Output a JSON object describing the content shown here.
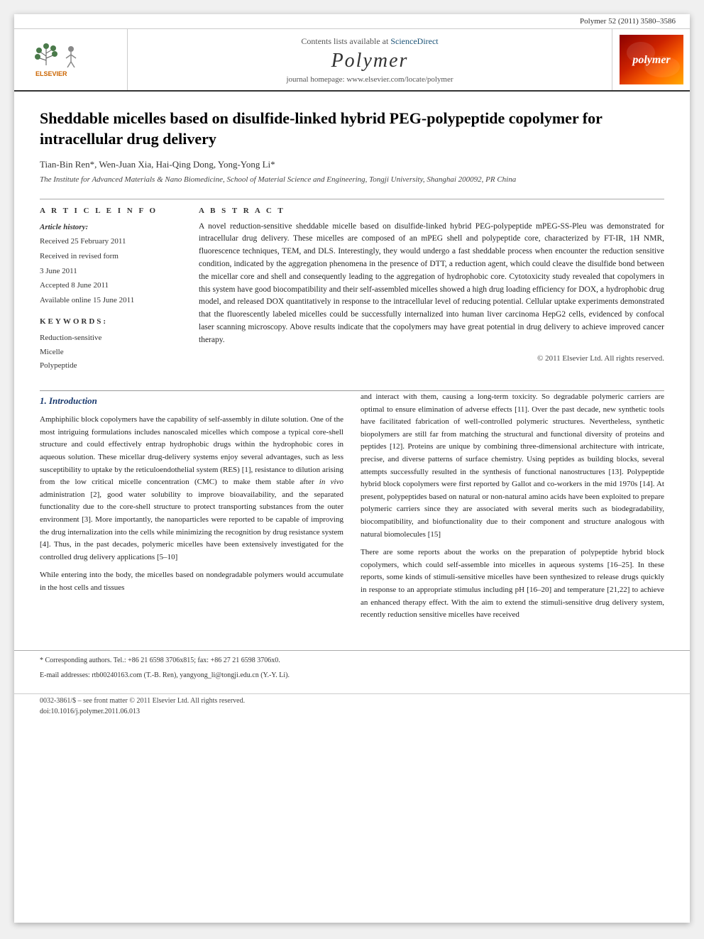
{
  "topbar": {
    "citation": "Polymer 52 (2011) 3580–3586"
  },
  "header": {
    "sciencedirect_text": "Contents lists available at",
    "sciencedirect_link": "ScienceDirect",
    "journal_name": "Polymer",
    "homepage_label": "journal homepage: www.elsevier.com/locate/polymer",
    "polymer_logo_text": "polymer"
  },
  "article": {
    "title": "Sheddable micelles based on disulfide-linked hybrid PEG-polypeptide copolymer for intracellular drug delivery",
    "authors": "Tian-Bin Ren*, Wen-Juan Xia, Hai-Qing Dong, Yong-Yong Li*",
    "affiliation": "The Institute for Advanced Materials & Nano Biomedicine, School of Material Science and Engineering, Tongji University, Shanghai 200092, PR China",
    "info_section_label": "A R T I C L E   I N F O",
    "history_label": "Article history:",
    "received": "Received 25 February 2011",
    "received_revised": "Received in revised form 3 June 2011",
    "accepted": "Accepted 8 June 2011",
    "available": "Available online 15 June 2011",
    "keywords_label": "Keywords:",
    "keyword1": "Reduction-sensitive",
    "keyword2": "Micelle",
    "keyword3": "Polypeptide",
    "abstract_label": "A B S T R A C T",
    "abstract_text": "A novel reduction-sensitive sheddable micelle based on disulfide-linked hybrid PEG-polypeptide mPEG-SS-Pleu was demonstrated for intracellular drug delivery. These micelles are composed of an mPEG shell and polypeptide core, characterized by FT-IR, 1H NMR, fluorescence techniques, TEM, and DLS. Interestingly, they would undergo a fast sheddable process when encounter the reduction sensitive condition, indicated by the aggregation phenomena in the presence of DTT, a reduction agent, which could cleave the disulfide bond between the micellar core and shell and consequently leading to the aggregation of hydrophobic core. Cytotoxicity study revealed that copolymers in this system have good biocompatibility and their self-assembled micelles showed a high drug loading efficiency for DOX, a hydrophobic drug model, and released DOX quantitatively in response to the intracellular level of reducing potential. Cellular uptake experiments demonstrated that the fluorescently labeled micelles could be successfully internalized into human liver carcinoma HepG2 cells, evidenced by confocal laser scanning microscopy. Above results indicate that the copolymers may have great potential in drug delivery to achieve improved cancer therapy.",
    "copyright": "© 2011 Elsevier Ltd. All rights reserved."
  },
  "section1": {
    "number": "1.",
    "title": "Introduction",
    "col1_para1": "Amphiphilic block copolymers have the capability of self-assembly in dilute solution. One of the most intriguing formulations includes nanoscaled micelles which compose a typical core-shell structure and could effectively entrap hydrophobic drugs within the hydrophobic cores in aqueous solution. These micellar drug-delivery systems enjoy several advantages, such as less susceptibility to uptake by the reticuloendothelial system (RES) [1], resistance to dilution arising from the low critical micelle concentration (CMC) to make them stable after in vivo administration [2], good water solubility to improve bioavailability, and the separated functionality due to the core-shell structure to protect transporting substances from the outer environment [3]. More importantly, the nanoparticles were reported to be capable of improving the drug internalization into the cells while minimizing the recognition by drug resistance system [4]. Thus, in the past decades, polymeric micelles have been extensively investigated for the controlled drug delivery applications [5–10]",
    "col1_para2": "While entering into the body, the micelles based on nondegradable polymers would accumulate in the host cells and tissues",
    "col2_para1": "and interact with them, causing a long-term toxicity. So degradable polymeric carriers are optimal to ensure elimination of adverse effects [11]. Over the past decade, new synthetic tools have facilitated fabrication of well-controlled polymeric structures. Nevertheless, synthetic biopolymers are still far from matching the structural and functional diversity of proteins and peptides [12]. Proteins are unique by combining three-dimensional architecture with intricate, precise, and diverse patterns of surface chemistry. Using peptides as building blocks, several attempts successfully resulted in the synthesis of functional nanostructures [13]. Polypeptide hybrid block copolymers were first reported by Gallot and co-workers in the mid 1970s [14]. At present, polypeptides based on natural or non-natural amino acids have been exploited to prepare polymeric carriers since they are associated with several merits such as biodegradability, biocompatibility, and biofunctionality due to their component and structure analogous with natural biomolecules [15]",
    "col2_para2": "There are some reports about the works on the preparation of polypeptide hybrid block copolymers, which could self-assemble into micelles in aqueous systems [16–25]. In these reports, some kinds of stimuli-sensitive micelles have been synthesized to release drugs quickly in response to an appropriate stimulus including pH [16–20] and temperature [21,22] to achieve an enhanced therapy effect. With the aim to extend the stimuli-sensitive drug delivery system, recently reduction sensitive micelles have received"
  },
  "footnotes": {
    "corresponding": "* Corresponding authors. Tel.: +86 21 6598 3706x815; fax: +86 27 21 6598 3706x0.",
    "email_label": "E-mail addresses:",
    "email1": "rtb00240163.com (T.-B. Ren),",
    "email2": "yangyong_li@tongji.edu.cn (Y.-Y. Li).",
    "issn": "0032-3861/$ – see front matter © 2011 Elsevier Ltd. All rights reserved.",
    "doi": "doi:10.1016/j.polymer.2011.06.013"
  }
}
